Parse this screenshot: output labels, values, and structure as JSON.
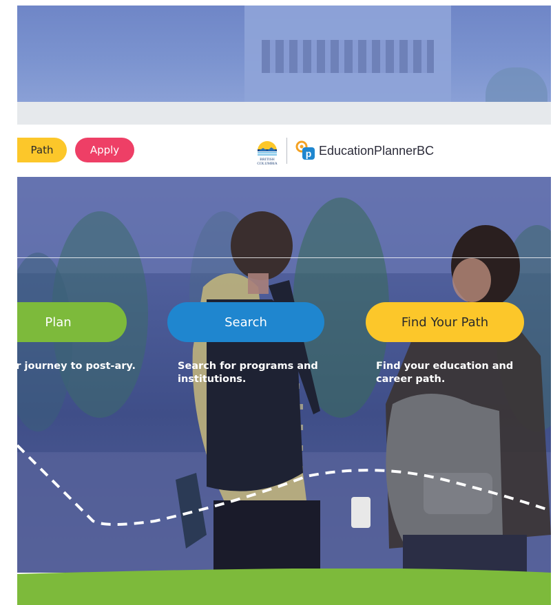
{
  "header": {
    "path_label": "Path",
    "apply_label": "Apply",
    "bc_logo_text_top": "BRITISH",
    "bc_logo_text_bottom": "COLUMBIA",
    "brand_name": "EducationPlannerBC"
  },
  "hero": {
    "cards": [
      {
        "label": "Plan",
        "description": "ur journey to post-ary."
      },
      {
        "label": "Search",
        "description": "Search for programs and institutions."
      },
      {
        "label": "Find Your Path",
        "description": "Find your education and career path."
      }
    ]
  },
  "colors": {
    "yellow": "#fcc72a",
    "pink": "#ee3f66",
    "green": "#7dba3b",
    "blue": "#1f86cf",
    "hero_overlay": "#4a5a96",
    "grey_band": "#e6e9ec"
  },
  "icons": {
    "bc_logo": "british-columbia-sun-logo",
    "ep_logo": "education-planner-bc-logo-icon"
  }
}
